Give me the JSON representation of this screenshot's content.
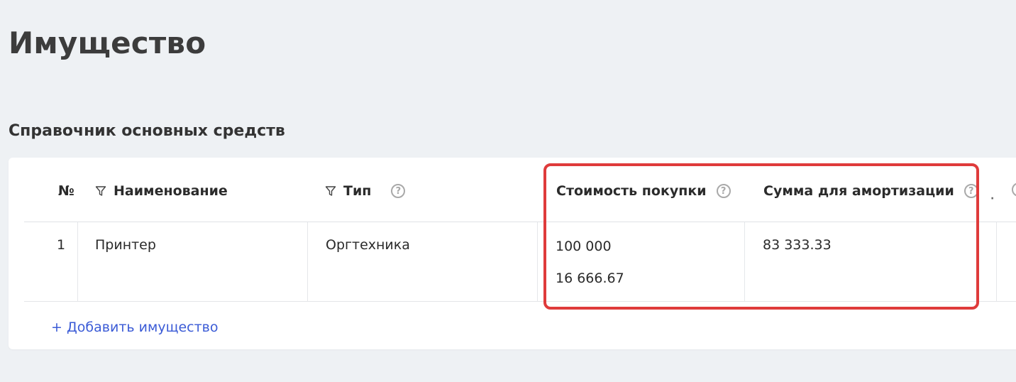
{
  "page": {
    "title": "Имущество"
  },
  "section": {
    "title": "Справочник основных средств"
  },
  "table": {
    "columns": {
      "number": "№",
      "name": "Наименование",
      "type": "Тип",
      "purchase_cost": "Стоимость покупки",
      "depreciation_amount": "Сумма для амортизации"
    },
    "rows": [
      {
        "number": "1",
        "name": "Принтер",
        "type": "Оргтехника",
        "purchase_cost": "100 000",
        "purchase_cost_secondary": "16 666.67",
        "depreciation_amount": "83 333.33"
      }
    ]
  },
  "actions": {
    "add_label": "+ Добавить имущество"
  },
  "icons": {
    "filter": "filter-icon",
    "help": "help-icon"
  },
  "colors": {
    "link": "#3b5bd6",
    "highlight": "#df3b3b",
    "background": "#eef1f4"
  }
}
